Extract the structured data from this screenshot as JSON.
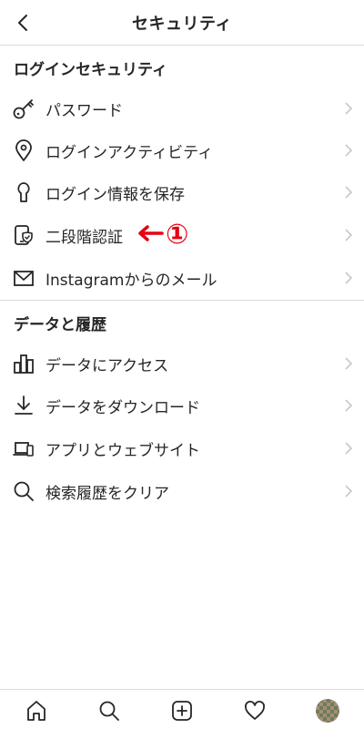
{
  "header": {
    "title": "セキュリティ",
    "back_icon": "chevron-left-icon"
  },
  "sections": {
    "login_security": {
      "title": "ログインセキュリティ",
      "items": [
        {
          "label": "パスワード",
          "icon": "key-icon"
        },
        {
          "label": "ログインアクティビティ",
          "icon": "location-pin-icon"
        },
        {
          "label": "ログイン情報を保存",
          "icon": "keyhole-icon"
        },
        {
          "label": "二段階認証",
          "icon": "phone-shield-icon"
        },
        {
          "label": "Instagramからのメール",
          "icon": "mail-icon"
        }
      ]
    },
    "data_history": {
      "title": "データと履歴",
      "items": [
        {
          "label": "データにアクセス",
          "icon": "bar-chart-icon"
        },
        {
          "label": "データをダウンロード",
          "icon": "download-icon"
        },
        {
          "label": "アプリとウェブサイト",
          "icon": "devices-icon"
        },
        {
          "label": "検索履歴をクリア",
          "icon": "search-icon"
        }
      ]
    }
  },
  "annotation": {
    "marker": "①",
    "color": "#e60012"
  },
  "tabbar": {
    "items": [
      "home-icon",
      "search-icon",
      "new-post-icon",
      "activity-heart-icon",
      "profile-avatar"
    ]
  },
  "colors": {
    "text": "#262626",
    "divider": "#dbdbdb",
    "chevron": "#c7c7c7",
    "annotation": "#e60012"
  }
}
